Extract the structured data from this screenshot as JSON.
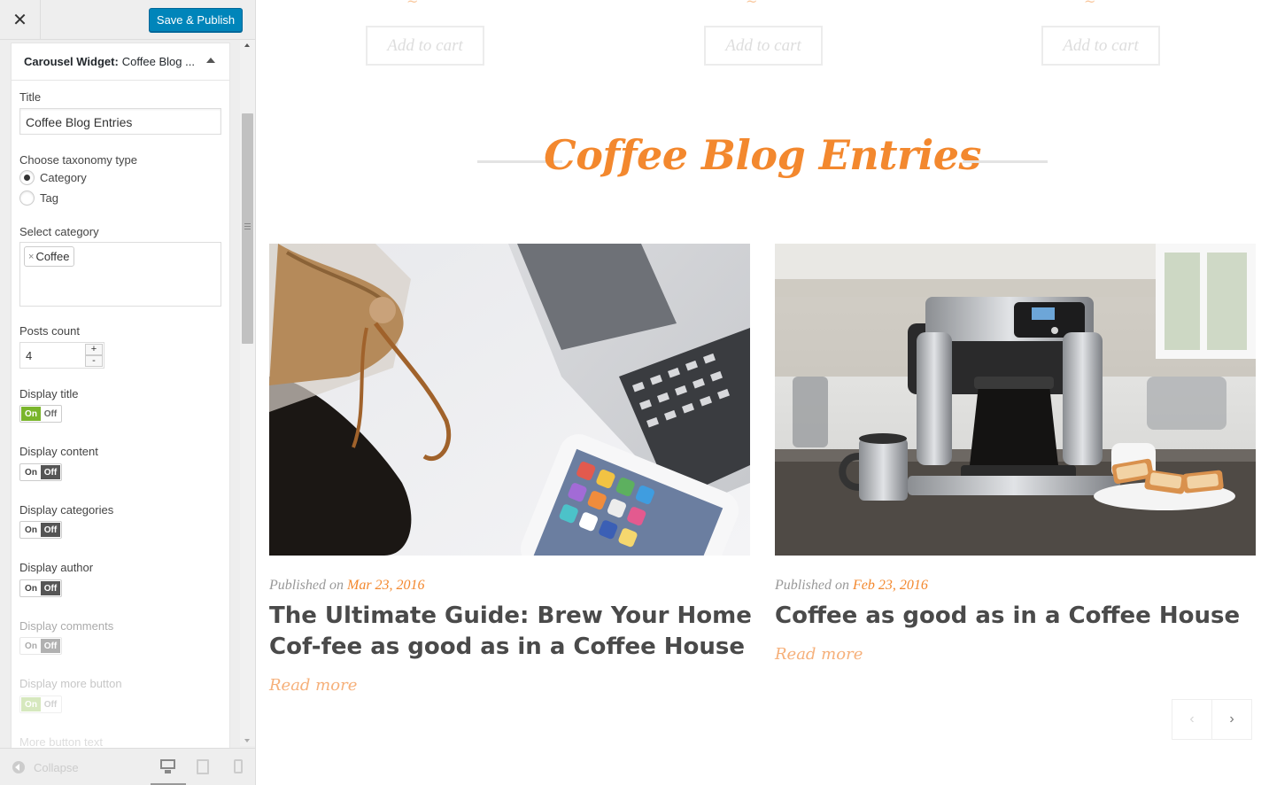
{
  "sidebar": {
    "close_label": "✕",
    "publish_label": "Save & Publish",
    "widget": {
      "type_label": "Carousel Widget:",
      "name": "Coffee Blog ..."
    },
    "fields": {
      "title_label": "Title",
      "title_value": "Coffee Blog Entries",
      "taxonomy_label": "Choose taxonomy type",
      "taxonomy_options": [
        "Category",
        "Tag"
      ],
      "taxonomy_selected": "Category",
      "category_label": "Select category",
      "category_chip": "Coffee",
      "category_chip_remove": "×",
      "posts_count_label": "Posts count",
      "posts_count_value": "4",
      "stepper_up": "+",
      "stepper_down": "-",
      "toggle_on": "On",
      "toggle_off": "Off",
      "display_title_label": "Display title",
      "display_title_state": "on",
      "display_content_label": "Display content",
      "display_content_state": "off",
      "display_categories_label": "Display categories",
      "display_categories_state": "off",
      "display_author_label": "Display author",
      "display_author_state": "off",
      "display_comments_label": "Display comments",
      "display_comments_state": "off",
      "display_more_label": "Display more button",
      "display_more_state": "on",
      "more_text_label": "More button text"
    },
    "footer": {
      "collapse_label": "Collapse"
    }
  },
  "preview": {
    "cart_label": "Add to cart",
    "section_title": "Coffee Blog Entries",
    "posts": [
      {
        "published_prefix": "Published on",
        "date": "Mar 23, 2016",
        "title": "The Ultimate Guide: Brew Your Home Cof-fee as good as in a Coffee House",
        "read_more": "Read more",
        "image_icon": "chemex-laptop-photo"
      },
      {
        "published_prefix": "Published on",
        "date": "Feb 23, 2016",
        "title": "Coffee as good as in a Coffee House",
        "read_more": "Read more",
        "image_icon": "coffee-maker-photo"
      }
    ],
    "nav": {
      "prev": "‹",
      "next": "›"
    },
    "colors": {
      "accent": "#f3882e",
      "publish": "#0085ba",
      "toggle_on": "#7ab52b"
    }
  }
}
